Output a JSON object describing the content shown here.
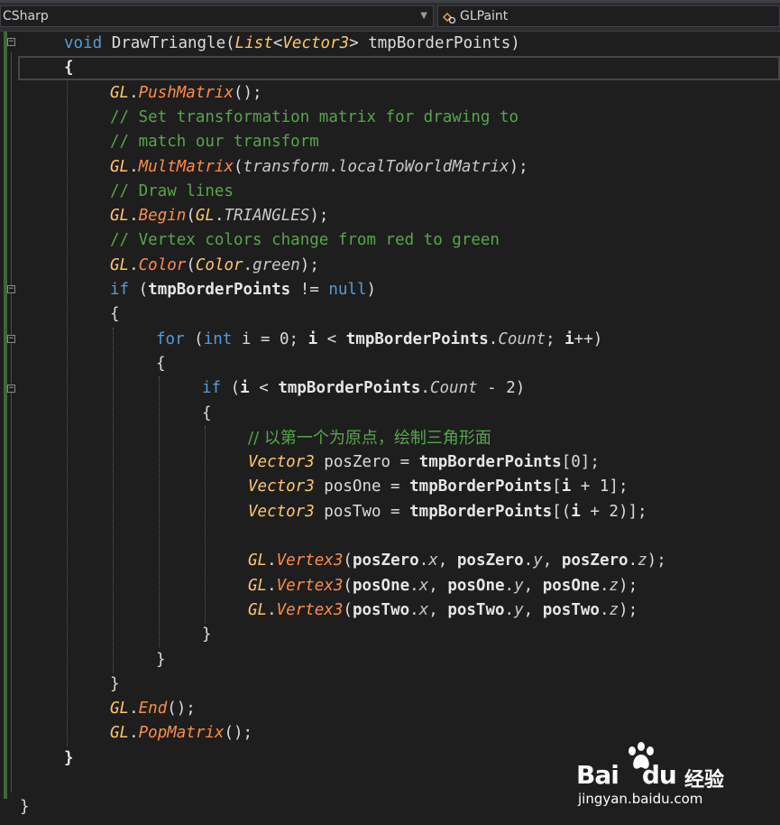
{
  "toolbar": {
    "scope_dropdown": "CSharp",
    "member_dropdown": "GLPaint",
    "member_icon": "class-member-icon"
  },
  "editor": {
    "lines": [
      {
        "indent": 1,
        "tokens": [
          [
            "kw",
            "void"
          ],
          [
            "pl",
            " DrawTriangle("
          ],
          [
            "ty",
            "List"
          ],
          [
            "pl",
            "<"
          ],
          [
            "ty",
            "Vector3"
          ],
          [
            "pl",
            "> tmpBorderPoints)"
          ]
        ]
      },
      {
        "indent": 1,
        "tokens": [
          [
            "bo",
            "{"
          ]
        ]
      },
      {
        "indent": 2,
        "tokens": [
          [
            "ty",
            "GL"
          ],
          [
            "pl",
            "."
          ],
          [
            "me",
            "PushMatrix"
          ],
          [
            "pl",
            "();"
          ]
        ]
      },
      {
        "indent": 2,
        "tokens": [
          [
            "co",
            "// Set transformation matrix for drawing to"
          ]
        ]
      },
      {
        "indent": 2,
        "tokens": [
          [
            "co",
            "// match our transform"
          ]
        ]
      },
      {
        "indent": 2,
        "tokens": [
          [
            "ty",
            "GL"
          ],
          [
            "pl",
            "."
          ],
          [
            "me",
            "MultMatrix"
          ],
          [
            "pl",
            "("
          ],
          [
            "pr",
            "transform"
          ],
          [
            "pl",
            "."
          ],
          [
            "pr",
            "localToWorldMatrix"
          ],
          [
            "pl",
            ");"
          ]
        ]
      },
      {
        "indent": 2,
        "tokens": [
          [
            "co",
            "// Draw lines"
          ]
        ]
      },
      {
        "indent": 2,
        "tokens": [
          [
            "ty",
            "GL"
          ],
          [
            "pl",
            "."
          ],
          [
            "me",
            "Begin"
          ],
          [
            "pl",
            "("
          ],
          [
            "ty",
            "GL"
          ],
          [
            "pl",
            "."
          ],
          [
            "pr",
            "TRIANGLES"
          ],
          [
            "pl",
            ");"
          ]
        ]
      },
      {
        "indent": 2,
        "tokens": [
          [
            "co",
            "// Vertex colors change from red to green"
          ]
        ]
      },
      {
        "indent": 2,
        "tokens": [
          [
            "ty",
            "GL"
          ],
          [
            "pl",
            "."
          ],
          [
            "me",
            "Color"
          ],
          [
            "pl",
            "("
          ],
          [
            "ty",
            "Color"
          ],
          [
            "pl",
            "."
          ],
          [
            "pr",
            "green"
          ],
          [
            "pl",
            ");"
          ]
        ]
      },
      {
        "indent": 2,
        "tokens": [
          [
            "kw",
            "if"
          ],
          [
            "pl",
            " ("
          ],
          [
            "bo",
            "tmpBorderPoints"
          ],
          [
            "pl",
            " != "
          ],
          [
            "kw",
            "null"
          ],
          [
            "pl",
            ")"
          ]
        ]
      },
      {
        "indent": 2,
        "tokens": [
          [
            "pl",
            "{"
          ]
        ]
      },
      {
        "indent": 3,
        "tokens": [
          [
            "kw",
            "for"
          ],
          [
            "pl",
            " ("
          ],
          [
            "kw",
            "int"
          ],
          [
            "pl",
            " i = 0; "
          ],
          [
            "bo",
            "i"
          ],
          [
            "pl",
            " < "
          ],
          [
            "bo",
            "tmpBorderPoints"
          ],
          [
            "pl",
            "."
          ],
          [
            "pr",
            "Count"
          ],
          [
            "pl",
            "; "
          ],
          [
            "bo",
            "i"
          ],
          [
            "pl",
            "++)"
          ]
        ]
      },
      {
        "indent": 3,
        "tokens": [
          [
            "pl",
            "{"
          ]
        ]
      },
      {
        "indent": 4,
        "tokens": [
          [
            "kw",
            "if"
          ],
          [
            "pl",
            " ("
          ],
          [
            "bo",
            "i"
          ],
          [
            "pl",
            " < "
          ],
          [
            "bo",
            "tmpBorderPoints"
          ],
          [
            "pl",
            "."
          ],
          [
            "pr",
            "Count"
          ],
          [
            "pl",
            " - 2)"
          ]
        ]
      },
      {
        "indent": 4,
        "tokens": [
          [
            "pl",
            "{"
          ]
        ]
      },
      {
        "indent": 5,
        "tokens": [
          [
            "co cn",
            "// 以第一个为原点，绘制三角形面"
          ]
        ]
      },
      {
        "indent": 5,
        "tokens": [
          [
            "ty",
            "Vector3"
          ],
          [
            "pl",
            " posZero = "
          ],
          [
            "bo",
            "tmpBorderPoints"
          ],
          [
            "pl",
            "[0];"
          ]
        ]
      },
      {
        "indent": 5,
        "tokens": [
          [
            "ty",
            "Vector3"
          ],
          [
            "pl",
            " posOne = "
          ],
          [
            "bo",
            "tmpBorderPoints"
          ],
          [
            "pl",
            "["
          ],
          [
            "bo",
            "i"
          ],
          [
            "pl",
            " + 1];"
          ]
        ]
      },
      {
        "indent": 5,
        "tokens": [
          [
            "ty",
            "Vector3"
          ],
          [
            "pl",
            " posTwo = "
          ],
          [
            "bo",
            "tmpBorderPoints"
          ],
          [
            "pl",
            "[("
          ],
          [
            "bo",
            "i"
          ],
          [
            "pl",
            " + 2)];"
          ]
        ]
      },
      {
        "indent": 5,
        "tokens": []
      },
      {
        "indent": 5,
        "tokens": [
          [
            "ty",
            "GL"
          ],
          [
            "pl",
            "."
          ],
          [
            "me",
            "Vertex3"
          ],
          [
            "pl",
            "("
          ],
          [
            "bo",
            "posZero"
          ],
          [
            "pl",
            "."
          ],
          [
            "pr",
            "x"
          ],
          [
            "pl",
            ", "
          ],
          [
            "bo",
            "posZero"
          ],
          [
            "pl",
            "."
          ],
          [
            "pr",
            "y"
          ],
          [
            "pl",
            ", "
          ],
          [
            "bo",
            "posZero"
          ],
          [
            "pl",
            "."
          ],
          [
            "pr",
            "z"
          ],
          [
            "pl",
            ");"
          ]
        ]
      },
      {
        "indent": 5,
        "tokens": [
          [
            "ty",
            "GL"
          ],
          [
            "pl",
            "."
          ],
          [
            "me",
            "Vertex3"
          ],
          [
            "pl",
            "("
          ],
          [
            "bo",
            "posOne"
          ],
          [
            "pl",
            "."
          ],
          [
            "pr",
            "x"
          ],
          [
            "pl",
            ", "
          ],
          [
            "bo",
            "posOne"
          ],
          [
            "pl",
            "."
          ],
          [
            "pr",
            "y"
          ],
          [
            "pl",
            ", "
          ],
          [
            "bo",
            "posOne"
          ],
          [
            "pl",
            "."
          ],
          [
            "pr",
            "z"
          ],
          [
            "pl",
            ");"
          ]
        ]
      },
      {
        "indent": 5,
        "tokens": [
          [
            "ty",
            "GL"
          ],
          [
            "pl",
            "."
          ],
          [
            "me",
            "Vertex3"
          ],
          [
            "pl",
            "("
          ],
          [
            "bo",
            "posTwo"
          ],
          [
            "pl",
            "."
          ],
          [
            "pr",
            "x"
          ],
          [
            "pl",
            ", "
          ],
          [
            "bo",
            "posTwo"
          ],
          [
            "pl",
            "."
          ],
          [
            "pr",
            "y"
          ],
          [
            "pl",
            ", "
          ],
          [
            "bo",
            "posTwo"
          ],
          [
            "pl",
            "."
          ],
          [
            "pr",
            "z"
          ],
          [
            "pl",
            ");"
          ]
        ]
      },
      {
        "indent": 4,
        "tokens": [
          [
            "pl",
            "}"
          ]
        ]
      },
      {
        "indent": 3,
        "tokens": [
          [
            "pl",
            "}"
          ]
        ]
      },
      {
        "indent": 2,
        "tokens": [
          [
            "pl",
            "}"
          ]
        ]
      },
      {
        "indent": 2,
        "tokens": [
          [
            "ty",
            "GL"
          ],
          [
            "pl",
            "."
          ],
          [
            "me",
            "End"
          ],
          [
            "pl",
            "();"
          ]
        ]
      },
      {
        "indent": 2,
        "tokens": [
          [
            "ty",
            "GL"
          ],
          [
            "pl",
            "."
          ],
          [
            "me",
            "PopMatrix"
          ],
          [
            "pl",
            "();"
          ]
        ]
      },
      {
        "indent": 1,
        "tokens": [
          [
            "bo",
            "}"
          ]
        ]
      },
      {
        "indent": 0,
        "tokens": []
      },
      {
        "indent": 0,
        "tokens": [
          [
            "pl",
            "}"
          ]
        ]
      }
    ]
  },
  "watermark": {
    "brand": "Bai",
    "brand_suffix": "du",
    "product": "经验",
    "url": "jingyan.baidu.com"
  }
}
